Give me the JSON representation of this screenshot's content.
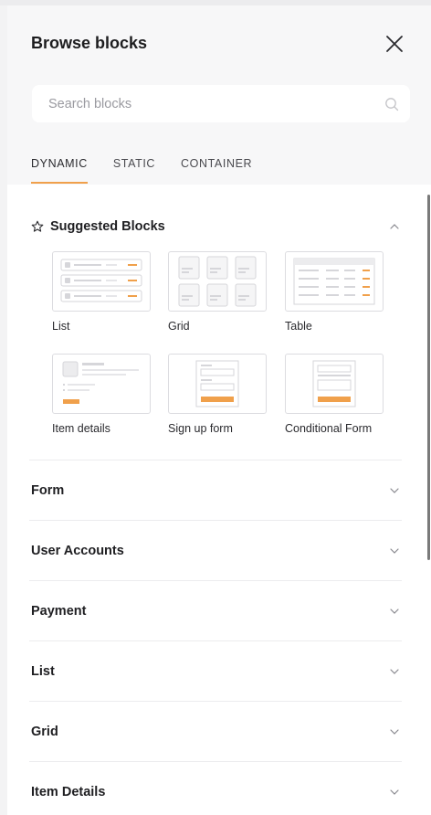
{
  "header": {
    "title": "Browse blocks"
  },
  "search": {
    "placeholder": "Search blocks"
  },
  "tabs": [
    {
      "label": "DYNAMIC",
      "active": true
    },
    {
      "label": "STATIC",
      "active": false
    },
    {
      "label": "CONTAINER",
      "active": false
    }
  ],
  "suggested": {
    "title": "Suggested Blocks",
    "expanded": true,
    "blocks": [
      {
        "label": "List",
        "icon": "list-block-thumb"
      },
      {
        "label": "Grid",
        "icon": "grid-block-thumb"
      },
      {
        "label": "Table",
        "icon": "table-block-thumb"
      },
      {
        "label": "Item details",
        "icon": "item-details-block-thumb"
      },
      {
        "label": "Sign up form",
        "icon": "signup-form-block-thumb"
      },
      {
        "label": "Conditional Form",
        "icon": "conditional-form-block-thumb"
      }
    ]
  },
  "sections": [
    {
      "label": "Form"
    },
    {
      "label": "User Accounts"
    },
    {
      "label": "Payment"
    },
    {
      "label": "List"
    },
    {
      "label": "Grid"
    },
    {
      "label": "Item Details"
    }
  ],
  "colors": {
    "accent": "#f0a04b",
    "panel_bg": "#f7f7f8",
    "content_bg": "#ffffff"
  }
}
